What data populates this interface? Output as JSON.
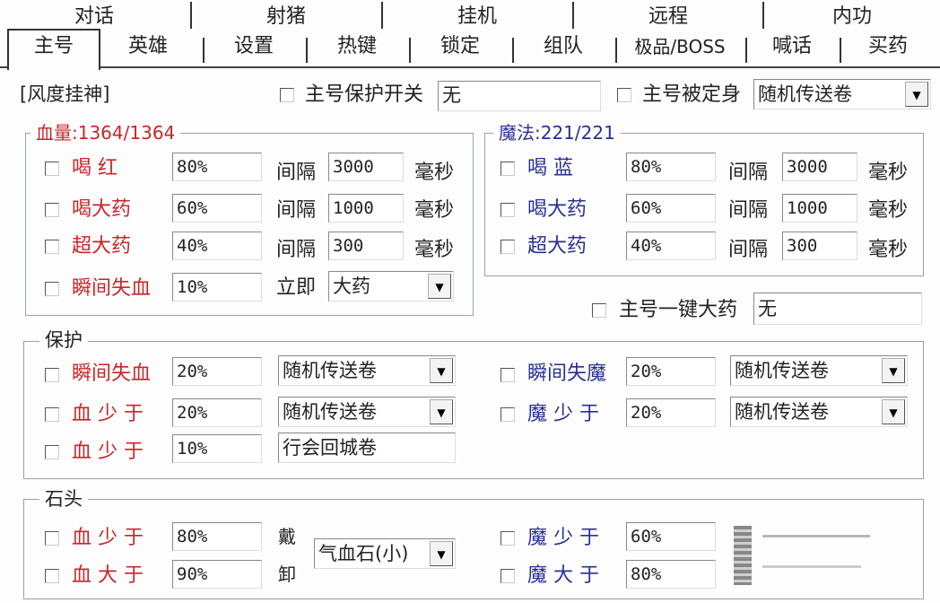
{
  "tabs_row1": [
    "对话",
    "射猪",
    "挂机",
    "远程",
    "内功"
  ],
  "tabs_row2": [
    "主号",
    "英雄",
    "设置",
    "热键",
    "锁定",
    "组队",
    "极品/BOSS",
    "喊话",
    "买药"
  ],
  "title": "[风度挂神]",
  "top": {
    "protect_switch_label": "主号保护开关",
    "protect_switch_value": "无",
    "frozen_label": "主号被定身",
    "frozen_value": "随机传送卷"
  },
  "hp_group": {
    "legend": "血量:1364/1364",
    "rows": [
      {
        "label": "喝 红",
        "value": "80%",
        "interval_label": "间隔",
        "interval": "3000",
        "unit": "毫秒"
      },
      {
        "label": "喝大药",
        "value": "60%",
        "interval_label": "间隔",
        "interval": "1000",
        "unit": "毫秒"
      },
      {
        "label": "超大药",
        "value": "40%",
        "interval_label": "间隔",
        "interval": "300",
        "unit": "毫秒"
      }
    ],
    "instant": {
      "label": "瞬间失血",
      "value": "10%",
      "now_label": "立即",
      "select": "大药"
    }
  },
  "mp_group": {
    "legend": "魔法:221/221",
    "rows": [
      {
        "label": "喝 蓝",
        "value": "80%",
        "interval_label": "间隔",
        "interval": "3000",
        "unit": "毫秒"
      },
      {
        "label": "喝大药",
        "value": "60%",
        "interval_label": "间隔",
        "interval": "1000",
        "unit": "毫秒"
      },
      {
        "label": "超大药",
        "value": "40%",
        "interval_label": "间隔",
        "interval": "300",
        "unit": "毫秒"
      }
    ]
  },
  "one_key": {
    "label": "主号一键大药",
    "value": "无"
  },
  "protect_group": {
    "legend": "保护",
    "left_rows": [
      {
        "label": "瞬间失血",
        "value": "20%",
        "select": "随机传送卷"
      },
      {
        "label": "血 少 于",
        "value": "20%",
        "select": "随机传送卷"
      },
      {
        "label": "血 少 于",
        "value": "10%",
        "select": "行会回城卷"
      }
    ],
    "right_rows": [
      {
        "label": "瞬间失魔",
        "value": "20%",
        "select": "随机传送卷"
      },
      {
        "label": "魔 少 于",
        "value": "20%",
        "select": "随机传送卷"
      }
    ]
  },
  "stone_group": {
    "legend": "石头",
    "left_rows": [
      {
        "label": "血 少 于",
        "value": "80%"
      },
      {
        "label": "血 大 于",
        "value": "90%"
      }
    ],
    "side_chars": [
      "戴",
      "卸"
    ],
    "select": "气血石(小)",
    "right_rows": [
      {
        "label": "魔 少 于",
        "value": "60%"
      },
      {
        "label": "魔 大 于",
        "value": "80%"
      }
    ]
  },
  "colors": {
    "hp_red": "#c8262a",
    "mp_blue": "#2a2f95"
  },
  "icons": {
    "dropdown": "chevron-down-icon"
  }
}
